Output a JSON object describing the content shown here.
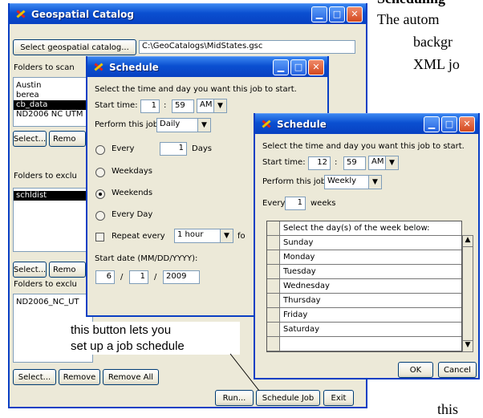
{
  "background_doc": {
    "line1": "Scheduling",
    "line2": "The autom",
    "line3": "backgr",
    "line4": "XML jo",
    "line5": "this"
  },
  "main_window": {
    "title": "Geospatial Catalog",
    "select_catalog_button": "Select geospatial catalog...",
    "catalog_path": "C:\\GeoCatalogs\\MidStates.gsc",
    "folders_to_scan_label": "Folders to scan",
    "folders_to_scan": [
      "Austin",
      "berea",
      "cb_data",
      "ND2006 NC UTM"
    ],
    "folders_to_scan_selected": 2,
    "select_button_1": "Select...",
    "remove_button_1": "Remo",
    "folders_to_exclude_label": "Folders to exclu",
    "folders_to_exclude": [
      "schldist"
    ],
    "select_button_2": "Select...",
    "remove_button_2": "Remo",
    "folders_to_exclude_label_2": "Folders to exclu",
    "folders_to_exclude_2": [
      "ND2006_NC_UT"
    ],
    "select_button_3": "Select...",
    "remove_button_3": "Remove",
    "remove_all_button": "Remove All",
    "run_button": "Run...",
    "schedule_job_button": "Schedule Job",
    "exit_button": "Exit"
  },
  "callout": {
    "line1": "this button lets you",
    "line2": "set up a job schedule"
  },
  "schedule1": {
    "title": "Schedule",
    "instruction": "Select the time and day you want this job to start.",
    "start_time_label": "Start time:",
    "hour": "1",
    "minute": "59",
    "ampm": "AM",
    "colon": ":",
    "perform_label": "Perform this job:",
    "perform_value": "Daily",
    "every_label": "Every",
    "every_value": "1",
    "days_label": "Days",
    "weekdays_label": "Weekdays",
    "weekends_label": "Weekends",
    "everyday_label": "Every Day",
    "repeat_label": "Repeat every",
    "repeat_value": "1 hour",
    "repeat_trail": "fo",
    "start_date_label": "Start date (MM/DD/YYYY):",
    "month": "6",
    "day": "1",
    "year": "2009",
    "slash": "/"
  },
  "schedule2": {
    "title": "Schedule",
    "instruction": "Select the time and day you want this job to start.",
    "start_time_label": "Start time:",
    "hour": "12",
    "minute": "59",
    "ampm": "AM",
    "colon": ":",
    "perform_label": "Perform this job:",
    "perform_value": "Weekly",
    "every_label": "Every",
    "every_value": "1",
    "weeks_label": "weeks",
    "grid_header": "Select the day(s) of the week below:",
    "days": [
      "Sunday",
      "Monday",
      "Tuesday",
      "Wednesday",
      "Thursday",
      "Friday",
      "Saturday"
    ],
    "ok_button": "OK",
    "cancel_button": "Cancel"
  },
  "colors": {
    "titlebar": "#0a4fd0",
    "window_face": "#ece9d8",
    "close_button": "#d3481e"
  }
}
